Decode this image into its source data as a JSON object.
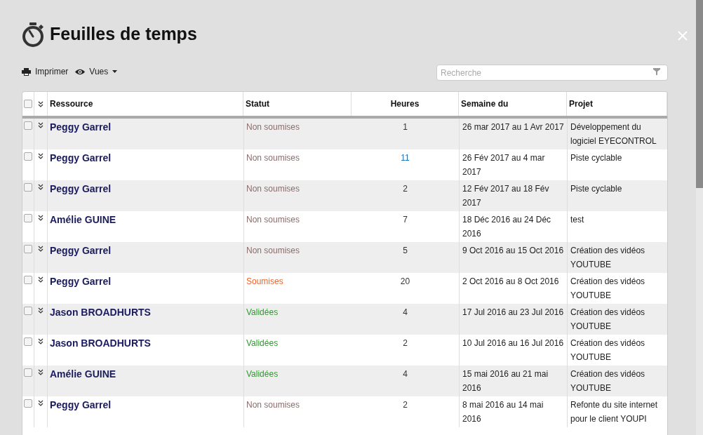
{
  "header": {
    "title": "Feuilles de temps"
  },
  "toolbar": {
    "print": "Imprimer",
    "views": "Vues",
    "search": {
      "placeholder": "Recherche"
    }
  },
  "table": {
    "select_all": {
      "checked": false
    },
    "columns": [
      "Ressource",
      "Statut",
      "Heures",
      "Semaine du",
      "Projet"
    ],
    "rows": [
      {
        "checked": false,
        "resource": "Peggy Garrel",
        "status": "Non soumises",
        "color": "#8a6d6d",
        "hours": "1",
        "hours_highlighted": false,
        "week": "26 mar 2017 au 1 Avr 2017",
        "project": "Développement du logiciel EYECONTROL"
      },
      {
        "checked": false,
        "resource": "Peggy Garrel",
        "status": "Non soumises",
        "color": "#8a6d6d",
        "hours": "11",
        "hours_highlighted": true,
        "week": "26 Fév 2017 au 4 mar 2017",
        "project": "Piste cyclable"
      },
      {
        "checked": false,
        "resource": "Peggy Garrel",
        "status": "Non soumises",
        "color": "#8a6d6d",
        "hours": "2",
        "hours_highlighted": false,
        "week": "12 Fév 2017 au 18 Fév 2017",
        "project": "Piste cyclable"
      },
      {
        "checked": false,
        "resource": "Amélie GUINE",
        "status": "Non soumises",
        "color": "#8a6d6d",
        "hours": "7",
        "hours_highlighted": false,
        "week": "18 Déc 2016 au 24 Déc 2016",
        "project": "test"
      },
      {
        "checked": false,
        "resource": "Peggy Garrel",
        "status": "Non soumises",
        "color": "#8a6d6d",
        "hours": "5",
        "hours_highlighted": false,
        "week": "9 Oct 2016 au 15 Oct 2016",
        "project": "Création des vidéos YOUTUBE"
      },
      {
        "checked": false,
        "resource": "Peggy Garrel",
        "status": "Soumises",
        "color": "#f0642a",
        "hours": "20",
        "hours_highlighted": false,
        "week": "2 Oct 2016 au 8 Oct 2016",
        "project": "Création des vidéos YOUTUBE"
      },
      {
        "checked": false,
        "resource": "Jason BROADHURTS",
        "status": "Validées",
        "color": "#2e9a2e",
        "hours": "4",
        "hours_highlighted": false,
        "week": "17 Jul 2016 au 23 Jul 2016",
        "project": "Création des vidéos YOUTUBE"
      },
      {
        "checked": false,
        "resource": "Jason BROADHURTS",
        "status": "Validées",
        "color": "#2e9a2e",
        "hours": "2",
        "hours_highlighted": false,
        "week": "10 Jul 2016 au 16 Jul 2016",
        "project": "Création des vidéos YOUTUBE"
      },
      {
        "checked": false,
        "resource": "Amélie GUINE",
        "status": "Validées",
        "color": "#2e9a2e",
        "hours": "4",
        "hours_highlighted": false,
        "week": "15 mai 2016 au 21 mai 2016",
        "project": "Création des vidéos YOUTUBE"
      },
      {
        "checked": false,
        "resource": "Peggy Garrel",
        "status": "Non soumises",
        "color": "#8a6d6d",
        "hours": "2",
        "hours_highlighted": false,
        "week": "8 mai 2016 au 14 mai 2016",
        "project": "Refonte du site internet pour le client YOUPI"
      }
    ]
  }
}
